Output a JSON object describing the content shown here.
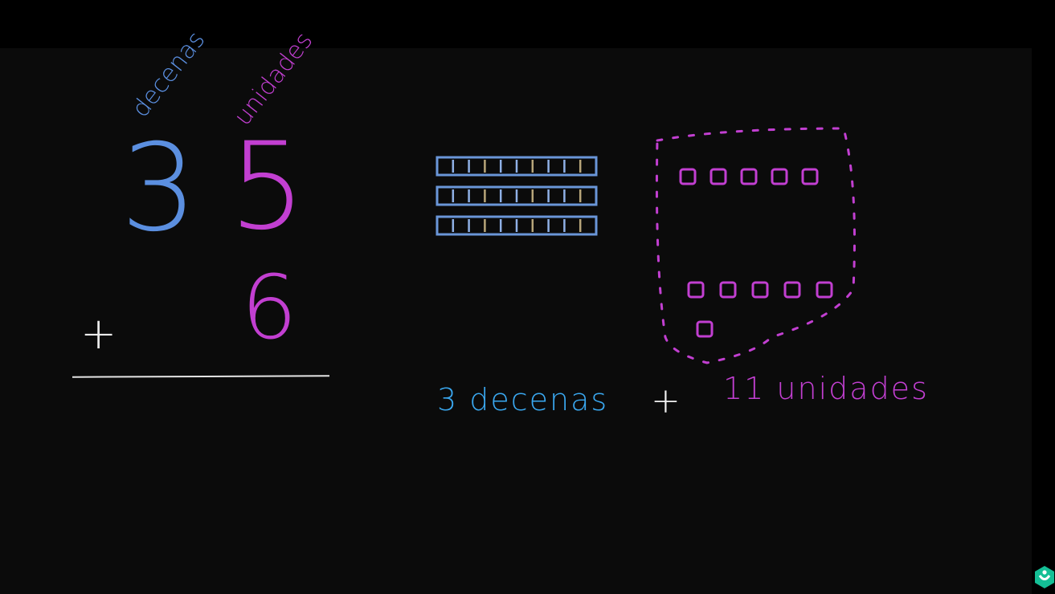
{
  "place_values": {
    "tens_label": "decenas",
    "ones_label": "unidades"
  },
  "problem": {
    "tens_digit": "3",
    "ones_digit": "5",
    "addend": "6",
    "operator": "+"
  },
  "blocks": {
    "ten_rods": 3,
    "unit_cubes": 11
  },
  "expression": {
    "tens_text": "3 decenas",
    "operator": "+",
    "ones_text": "11 unidades"
  },
  "colors": {
    "tens": "#5b8fe0",
    "ones": "#c23fd1",
    "chalk": "#e5e5e5",
    "expression_tens": "#3aa8f0"
  },
  "icons": {
    "logo": "khan-academy-logo-icon"
  }
}
